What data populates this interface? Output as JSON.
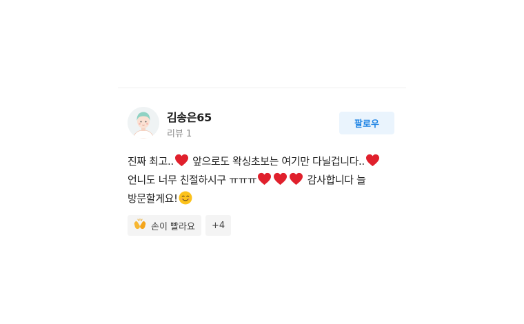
{
  "review": {
    "user": {
      "name": "김송은65",
      "review_count_label": "리뷰 1",
      "avatar": "cartoon-person-avatar"
    },
    "follow_label": "팔로우",
    "text": {
      "part1": "진짜 최고..",
      "part2": " 앞으로도 왁싱초보는 여기만 다닐겁니다..",
      "part3": " 언니도 너무 친절하시구 ㅠㅠㅠ",
      "part4": " 감사합니다 늘 방문할게요!"
    },
    "text_emojis": [
      "red-heart",
      "red-heart",
      "red-heart",
      "red-heart",
      "red-heart",
      "smiling-face"
    ],
    "reactions": [
      {
        "icon": "clapping-hands-icon",
        "label": "손이 빨라요"
      },
      {
        "label": "+4"
      }
    ]
  },
  "colors": {
    "accent": "#1d83e4",
    "follow_bg": "#eaf4fd",
    "heart": "#e0202c",
    "chip_bg": "#f4f4f4",
    "muted_text": "#8c8c8c"
  }
}
